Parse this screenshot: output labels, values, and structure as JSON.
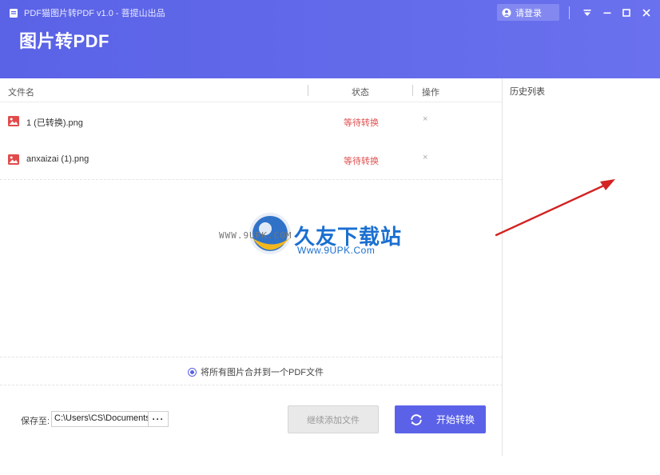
{
  "window": {
    "title": "PDF猫图片转PDF v1.0 - 菩提山出品",
    "login_label": "请登录",
    "controls": [
      "menu-icon",
      "minimize-icon",
      "maximize-icon",
      "close-icon"
    ]
  },
  "header": {
    "big_title": "图片转PDF",
    "color": "#5a62e6"
  },
  "table": {
    "headers": {
      "name": "文件名",
      "status": "状态",
      "operation": "操作"
    },
    "rows": [
      {
        "name": "1 (已转换).png",
        "status": "等待转换",
        "action": "×"
      },
      {
        "name": "anxaizai (1).png",
        "status": "等待转换",
        "action": "×"
      }
    ]
  },
  "watermark": {
    "url_left": "WWW.9UPK.COM",
    "brand": "久友下载站",
    "url": "Www.9UPK.Com"
  },
  "merge_option": {
    "label": "将所有图片合并到一个PDF文件",
    "checked": true
  },
  "footer": {
    "save_label": "保存至:",
    "path_value": "C:\\Users\\CS\\Documents",
    "browse_label": "···",
    "add_button": "继续添加文件",
    "start_button": "开始转换"
  },
  "history": {
    "title": "历史列表"
  }
}
